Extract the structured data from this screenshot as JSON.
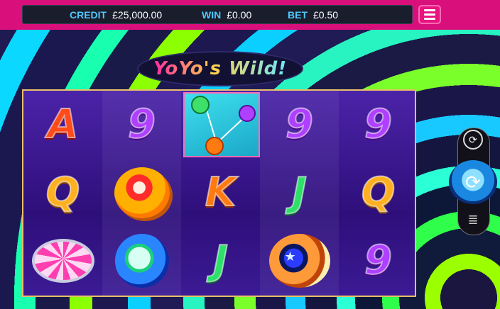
{
  "hud": {
    "credit_label": "CREDIT",
    "credit_value": "£25,000.00",
    "win_label": "WIN",
    "win_value": "£0.00",
    "bet_label": "BET",
    "bet_value": "£0.50"
  },
  "logo": {
    "title": "YoYo's Wild!"
  },
  "reels": [
    [
      "A",
      "Q",
      "candy-yoyo"
    ],
    [
      "9",
      "red-yoyo",
      "blue-yoyo"
    ],
    [
      "wild-yoyo",
      "K",
      "J"
    ],
    [
      "9",
      "J",
      "star-yoyo"
    ],
    [
      "9",
      "Q",
      "9"
    ]
  ],
  "controls": {
    "autoplay_icon": "autoplay-icon",
    "spin_icon": "spin-icon",
    "coins_icon": "coin-stack-icon",
    "menu_icon": "hamburger-menu-icon"
  },
  "colors": {
    "top_bar": "#d9107b",
    "credit_label": "#4fc8ff",
    "reel_frame": "#e8c16a"
  }
}
